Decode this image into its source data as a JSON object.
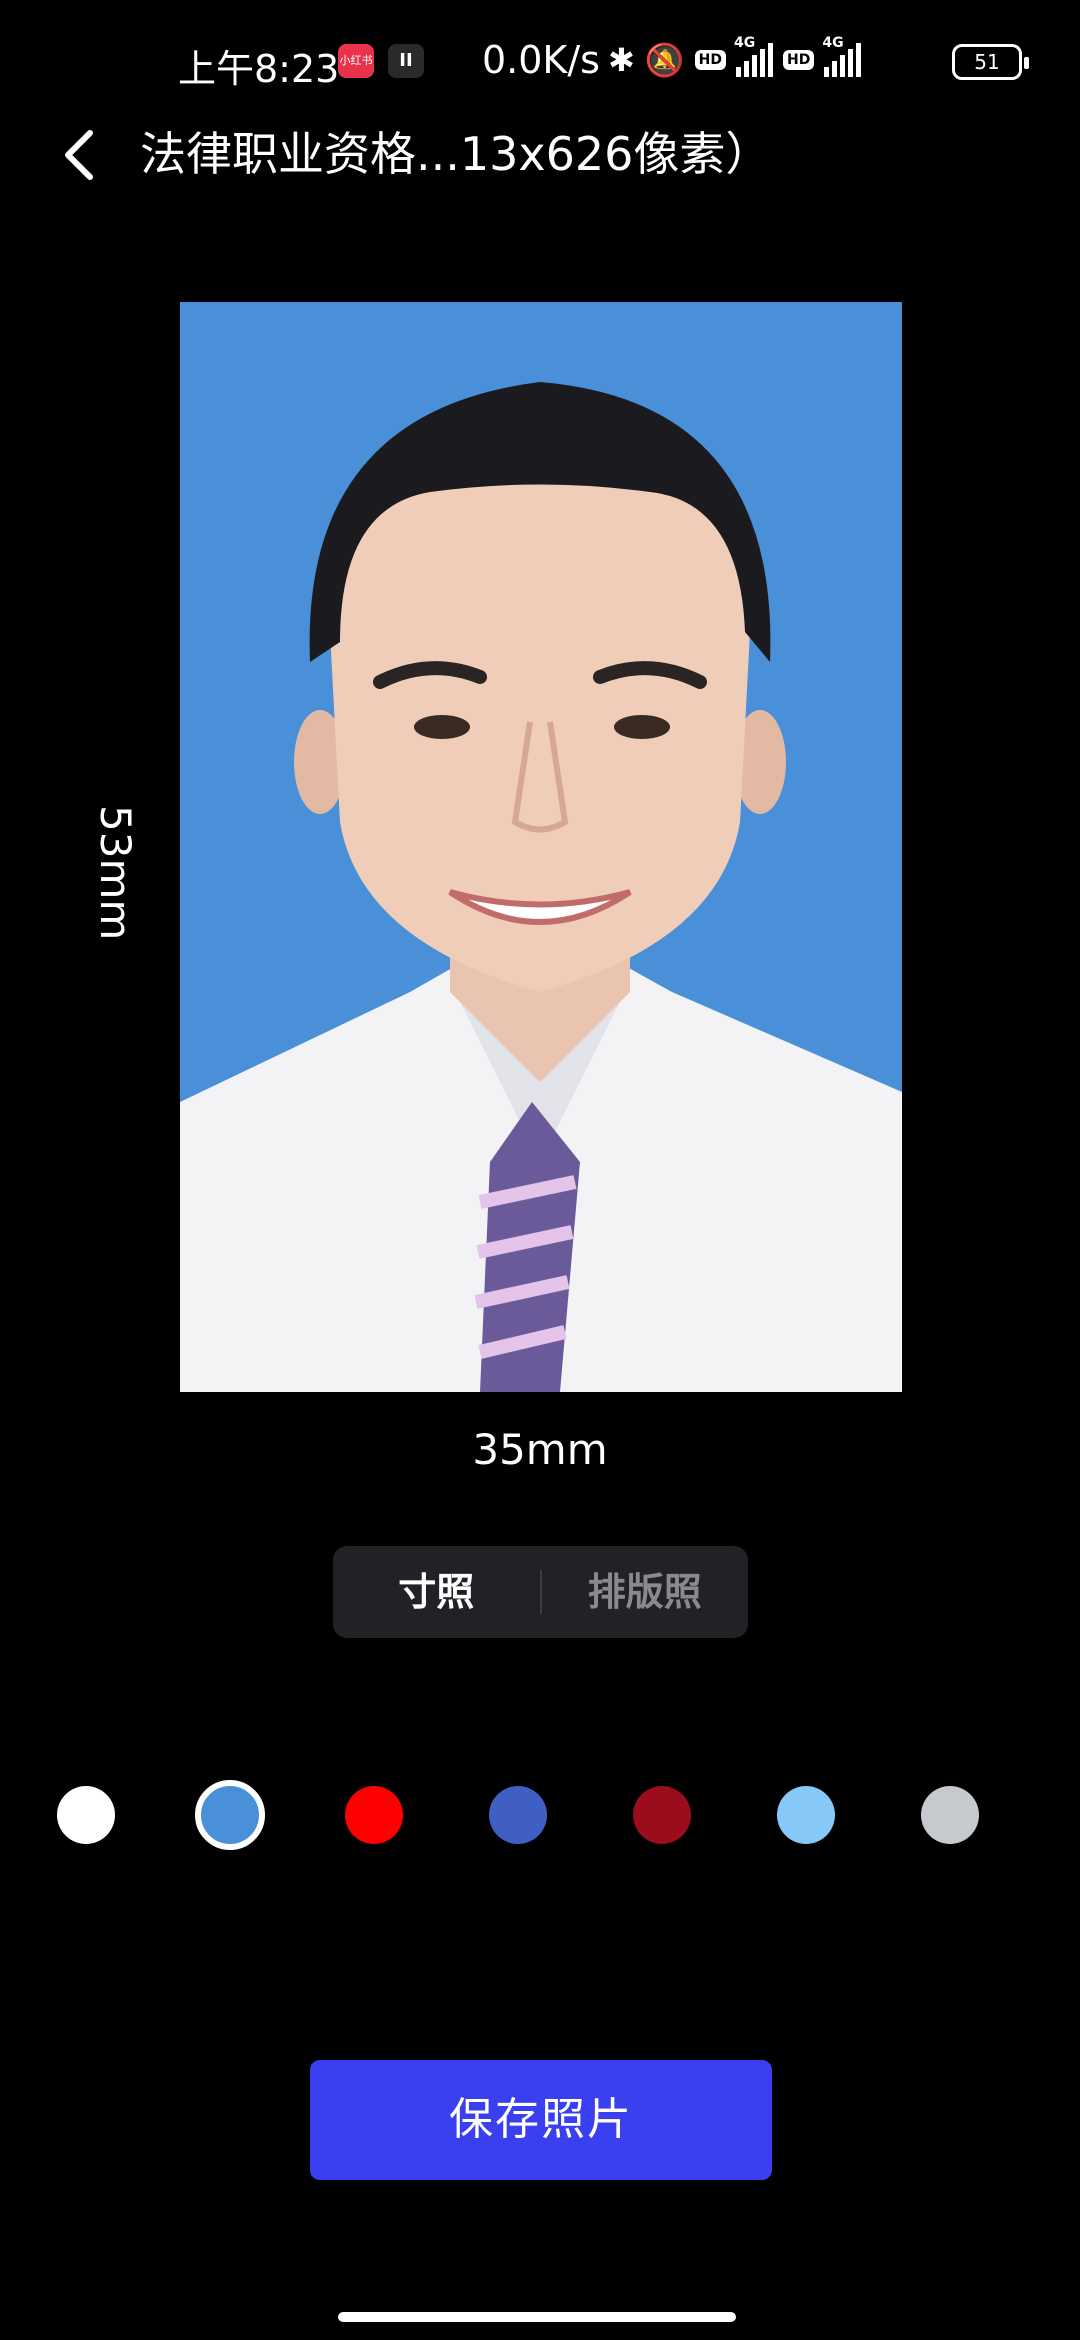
{
  "status_bar": {
    "time": "上午8:23",
    "app_badge": "小红书",
    "network_speed": "0.0K/s",
    "network_type": "4G",
    "hd_label": "HD",
    "battery": "51"
  },
  "header": {
    "title": "法律职业资格...13x626像素）"
  },
  "photo": {
    "background_color": "#4a90d9",
    "height_label": "53mm",
    "width_label": "35mm"
  },
  "segmented": {
    "tabs": [
      {
        "label": "寸照",
        "active": true
      },
      {
        "label": "排版照",
        "active": false
      }
    ]
  },
  "colors": {
    "swatches": [
      {
        "name": "white",
        "hex": "#ffffff",
        "selected": false
      },
      {
        "name": "blue",
        "hex": "#4a90d9",
        "selected": true
      },
      {
        "name": "red",
        "hex": "#ff0000",
        "selected": false
      },
      {
        "name": "dark-blue",
        "hex": "#3f5fc4",
        "selected": false
      },
      {
        "name": "dark-red",
        "hex": "#9b0c1c",
        "selected": false
      },
      {
        "name": "light-blue",
        "hex": "#86c8f8",
        "selected": false
      },
      {
        "name": "gray",
        "hex": "#c6c9cd",
        "selected": false
      }
    ],
    "accent": "#3a3ff0"
  },
  "actions": {
    "save_label": "保存照片"
  }
}
